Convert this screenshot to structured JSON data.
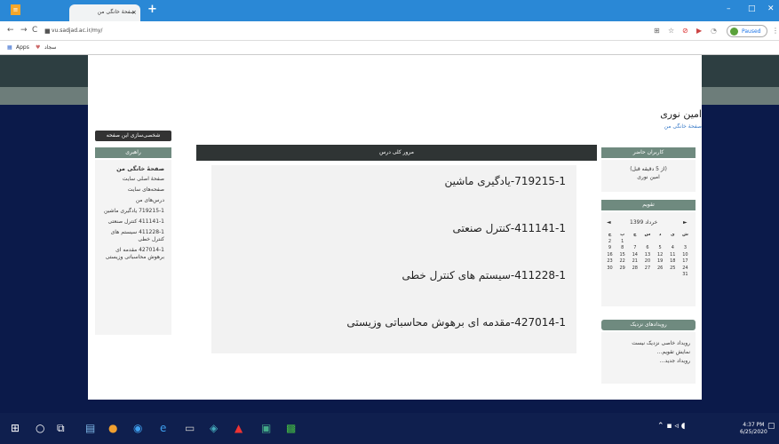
{
  "browser": {
    "tab_title": "صفحهٔ خانگی من",
    "tab_close": "×",
    "new_tab": "+",
    "url": "vu.sadjad.ac.ir/my/",
    "bookmarks_apps": "Apps",
    "bookmark_1": "سجاد",
    "account_label": "Paused",
    "minimize": "–",
    "maximize": "□",
    "close": "✕"
  },
  "header": {
    "user_name": "امین نوری",
    "home_link": "صفحهٔ خانگی من"
  },
  "customize_button": "شخصی‌سازی این صفحه",
  "nav_block": {
    "title": "راهبری",
    "items": [
      {
        "label": "صفحهٔ خانگی من",
        "bold": true
      },
      {
        "label": "صفحهٔ اصلی سایت"
      },
      {
        "label": "صفحه‌های سایت"
      },
      {
        "label": "درس‌های من"
      },
      {
        "label": "719215-1 یادگیری ماشین"
      },
      {
        "label": "411141-1 کنترل صنعتی"
      },
      {
        "label": "411228-1 سیستم های کنترل خطی"
      },
      {
        "label": "427014-1 مقدمه ای برهوش محاسباتی وزیستی"
      }
    ]
  },
  "overview": {
    "title": "مرور کلی درس",
    "courses": [
      "719215-1-یادگیری ماشین",
      "411141-1-کنترل صنعتی",
      "411228-1-سیستم های کنترل خطی",
      "427014-1-مقدمه ای برهوش محاسباتی وزیستی"
    ]
  },
  "online_users": {
    "title": "کاربران حاضر",
    "period": "(از 5 دقیقه قبل)",
    "user": "امین نوری"
  },
  "calendar": {
    "title": "تقویم",
    "month": "خرداد 1399",
    "prev": "◄",
    "next": "►",
    "weekdays": [
      "ش",
      "ی",
      "د",
      "س",
      "چ",
      "پ",
      "ج"
    ],
    "weeks": [
      [
        "",
        "",
        "",
        "",
        "",
        "1",
        "2"
      ],
      [
        "3",
        "4",
        "5",
        "6",
        "7",
        "8",
        "9"
      ],
      [
        "10",
        "11",
        "12",
        "13",
        "14",
        "15",
        "16"
      ],
      [
        "17",
        "18",
        "19",
        "20",
        "21",
        "22",
        "23"
      ],
      [
        "24",
        "25",
        "26",
        "27",
        "28",
        "29",
        "30"
      ],
      [
        "31",
        "",
        "",
        "",
        "",
        "",
        ""
      ]
    ]
  },
  "upcoming": {
    "title": "رویدادهای نزدیک",
    "empty": "رویداد خاصی نزدیک نیست",
    "go_calendar": "نمایش تقویم...",
    "new_event": "رویداد جدید..."
  },
  "taskbar": {
    "time": "4:37 PM",
    "date": "6/25/2020"
  }
}
